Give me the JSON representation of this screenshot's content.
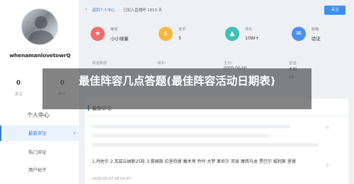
{
  "sidebar": {
    "username": "whenamanlovetowrQ",
    "following": {
      "count": "0",
      "label": "关注"
    },
    "fans": {
      "count": "0",
      "label": "粉丝"
    },
    "menu_title": "个人中心",
    "menu": [
      {
        "label": "最新评论",
        "active": true
      },
      {
        "label": "热门评论",
        "active": false
      },
      {
        "label": "用户帖子",
        "active": false
      }
    ]
  },
  "header": {
    "back_label": "返回个人中心",
    "joined_text": "已加入直播吧 1813 天",
    "follow_label": "关注"
  },
  "overview": [
    {
      "title": "等级",
      "value": "小小球童",
      "icon": "medal-icon",
      "color": "#f26d6d"
    },
    {
      "title": "金币",
      "value": "5",
      "icon": "coin-icon",
      "color": "#f6b73c"
    },
    {
      "title": "排名",
      "value": "10W+",
      "icon": "rank-icon",
      "color": "#3dc0b8"
    },
    {
      "title": "邮箱",
      "value": "验证",
      "icon": "mail-icon",
      "color": "#4c8ff2"
    }
  ],
  "info": {
    "labels": [
      "球迷数据",
      "城市：",
      "生日：",
      "星座："
    ],
    "birthday": "0000-00-00",
    "star_sign": "未知",
    "extra_value": "18"
  },
  "banner_title": "最佳阵容几点答题(最佳阵容活动日期表)",
  "comments": {
    "title": "最新评论",
    "items": [
      {
        "text": "1.丹佐尔 2.瓦兹丘纳斯25轮 3.詹姆斯 拉里伯德 魔术师 乔丹 大梦 奥尼尔 邓肯 摩西马龙 贾巴尔 威利斯 里德",
        "date": "2020-05-07 09:03:47"
      }
    ]
  }
}
